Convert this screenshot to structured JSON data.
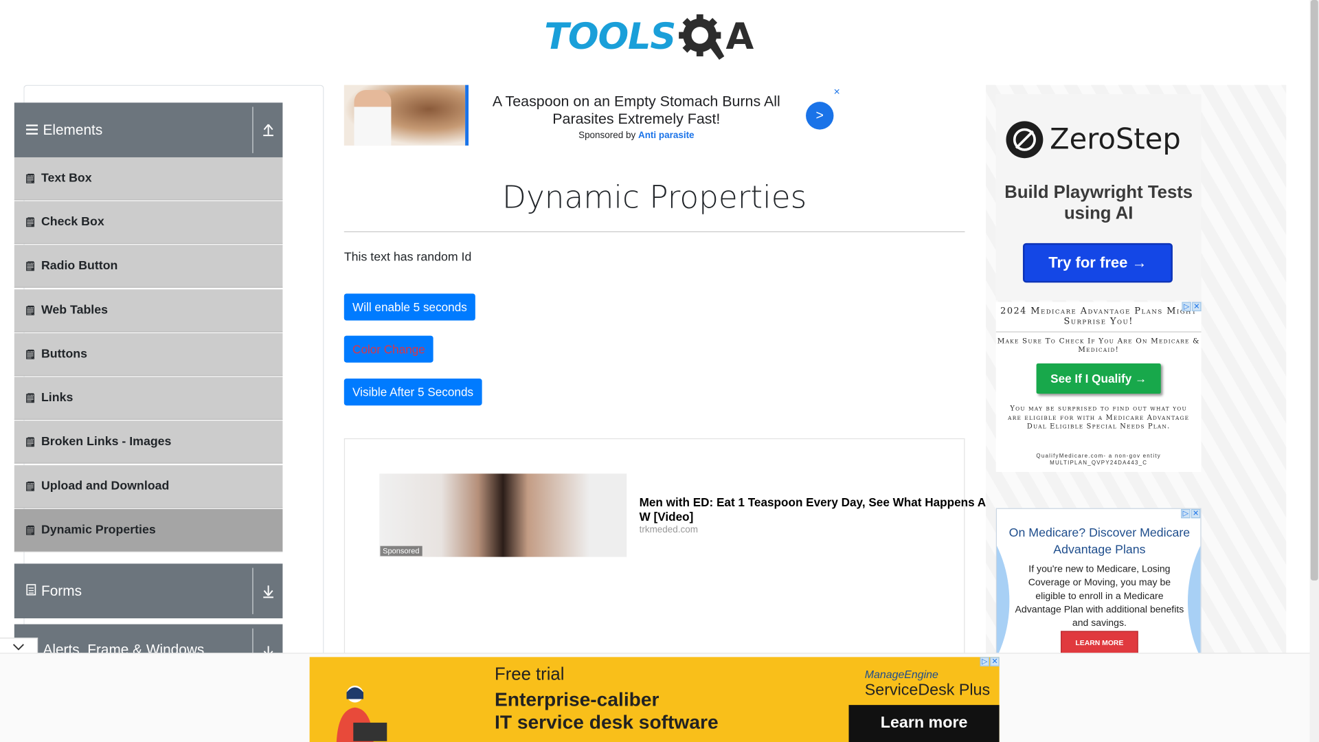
{
  "header": {
    "logo_text_left": "TOOLS",
    "logo_text_right": "A",
    "logo_icon": "gear-q-icon"
  },
  "sidebar": {
    "elements_group": {
      "label": "Elements",
      "icon": "hamburger-icon",
      "toggle_icon": "collapse-up-icon"
    },
    "items": [
      {
        "label": "Text Box",
        "active": false
      },
      {
        "label": "Check Box",
        "active": false
      },
      {
        "label": "Radio Button",
        "active": false
      },
      {
        "label": "Web Tables",
        "active": false
      },
      {
        "label": "Buttons",
        "active": false
      },
      {
        "label": "Links",
        "active": false
      },
      {
        "label": "Broken Links - Images",
        "active": false
      },
      {
        "label": "Upload and Download",
        "active": false
      },
      {
        "label": "Dynamic Properties",
        "active": true
      }
    ],
    "forms_group": {
      "label": "Forms",
      "icon": "form-icon",
      "toggle_icon": "expand-down-icon"
    },
    "alerts_group": {
      "label": "Alerts, Frame & Windows",
      "icon": "window-icon",
      "toggle_icon": "expand-down-icon"
    }
  },
  "top_ad": {
    "headline": "A Teaspoon on an Empty Stomach Burns All Parasites Extremely Fast!",
    "sponsored_prefix": "Sponsored by",
    "sponsor": "Anti parasite",
    "go_label": ">",
    "close_label": "×"
  },
  "main": {
    "title": "Dynamic Properties",
    "random_id_text": "This text has random Id",
    "buttons": {
      "enable_after": "Will enable 5 seconds",
      "color_change": "Color Change",
      "visible_after": "Visible After 5 Seconds"
    }
  },
  "inline_ad": {
    "headline": "Men with ED: Eat 1 Teaspoon Every Day, See What Happens A W [Video]",
    "domain": "trkmeded.com",
    "sponsored_tag": "Sponsored"
  },
  "right_ads": {
    "zerostep": {
      "brand": "ZeroStep",
      "tagline": "Build Playwright Tests using AI",
      "cta": "Try for free →"
    },
    "medicare1": {
      "title": "2024 Medicare Advantage Plans Might Surprise You!",
      "subtitle": "Make Sure To Check If You Are On Medicare & Medicaid!",
      "cta": "See If I Qualify →",
      "body": "You may be surprised to find out what you are eligible for with a Medicare Advantage Dual Eligible Special Needs Plan.",
      "footer1": "QualifyMedicare.com- a non-gov entity",
      "footer2": "MULTIPLAN_QVPY24DA443_C"
    },
    "medicare2": {
      "headline": "On Medicare? Discover Medicare Advantage Plans",
      "body": "If you're new to Medicare, Losing Coverage or Moving, you may be eligible to enroll in a Medicare Advantage Plan with additional benefits and savings.",
      "cta": "LEARN MORE"
    }
  },
  "bottom_ad": {
    "line1": "Free trial",
    "line2": "Enterprise-caliber",
    "line3": "IT service desk software",
    "brand1": "ManageEngine",
    "brand2": "ServiceDesk Plus",
    "cta": "Learn more"
  },
  "colors": {
    "primary_button": "#007bff",
    "sidebar_header": "#6c757d",
    "sidebar_item": "#cccccc",
    "sidebar_active": "#a5a5a5",
    "logo_blue": "#1a9fd9"
  }
}
